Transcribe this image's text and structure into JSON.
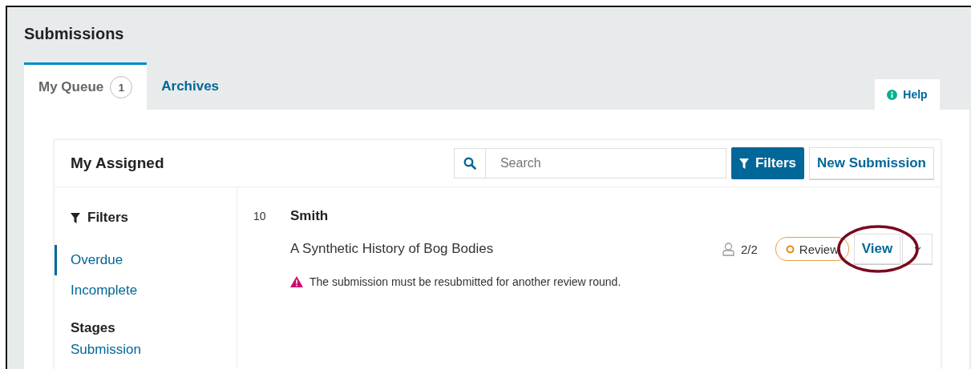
{
  "page_title": "Submissions",
  "tabs": [
    {
      "label": "My Queue",
      "badge": "1",
      "selected": true
    },
    {
      "label": "Archives",
      "selected": false
    }
  ],
  "help": {
    "label": "Help"
  },
  "panel": {
    "title": "My Assigned",
    "search": {
      "placeholder": "Search"
    },
    "filters_button": "Filters",
    "new_button": "New Submission"
  },
  "sidebar": {
    "heading": "Filters",
    "items": [
      {
        "label": "Overdue",
        "selected": true
      },
      {
        "label": "Incomplete",
        "selected": false
      }
    ],
    "sections": [
      {
        "heading": "Stages",
        "items": [
          {
            "label": "Submission",
            "selected": false
          }
        ]
      }
    ]
  },
  "submissions": [
    {
      "id": "10",
      "author": "Smith",
      "title": "A Synthetic History of Bog Bodies",
      "reviewers": "2/2",
      "stage": "Review",
      "view": "View",
      "highlighted": true,
      "notice": "The submission must be resubmitted for another review round."
    }
  ]
}
